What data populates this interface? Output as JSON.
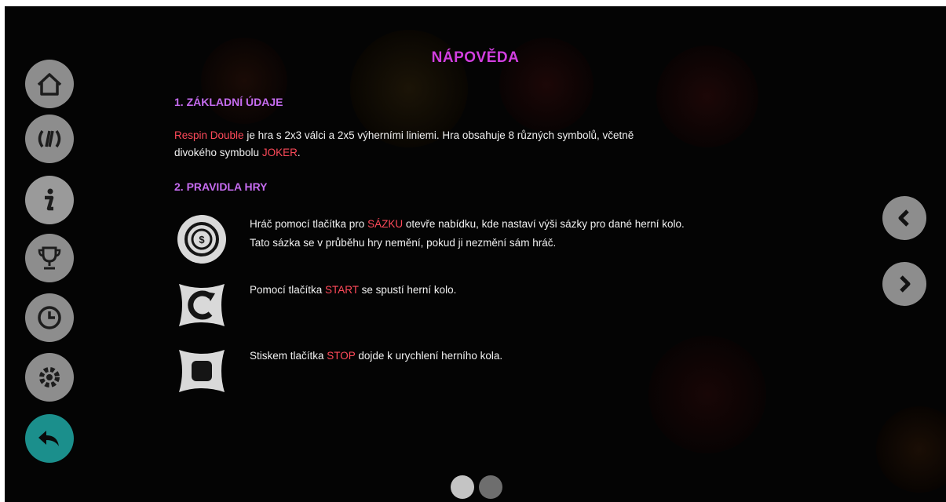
{
  "title": "NÁPOVĚDA",
  "sections": [
    {
      "heading": "1. ZÁKLADNÍ ÚDAJE"
    },
    {
      "heading": "2. PRAVIDLA HRY"
    }
  ],
  "intro": {
    "game_name": "Respin Double",
    "text_a": " je hra s 2x3 válci a 2x5 výherními liniemi. Hra obsahuje 8 různých symbolů, včetně",
    "text_b": "divokého symbolu ",
    "wild": "JOKER",
    "text_c": "."
  },
  "rules": [
    {
      "icon": "bet-coin-icon",
      "pre": "Hráč pomocí tlačítka pro ",
      "key": "SÁZKU",
      "post": " otevře nabídku, kde nastaví výši sázky pro dané herní kolo.",
      "line2": "Tato sázka se v průběhu hry nemění, pokud ji nezmění sám hráč."
    },
    {
      "icon": "start-icon",
      "pre": "Pomocí tlačítka ",
      "key": "START",
      "post": " se spustí herní kolo.",
      "line2": ""
    },
    {
      "icon": "stop-icon",
      "pre": "Stiskem tlačítka ",
      "key": "STOP",
      "post": " dojde k urychlení herního kola.",
      "line2": ""
    }
  ],
  "nav": [
    "home-icon",
    "paytable-icon",
    "info-icon",
    "trophy-icon",
    "history-icon",
    "settings-icon",
    "back-icon"
  ],
  "pagination": {
    "pages": 2,
    "current": 1
  },
  "colors": {
    "title": "#d23fe0",
    "heading": "#c66cf0",
    "highlight": "#ff4a5a",
    "button": "#8d8d8d",
    "back_button": "#1b8f8c"
  }
}
